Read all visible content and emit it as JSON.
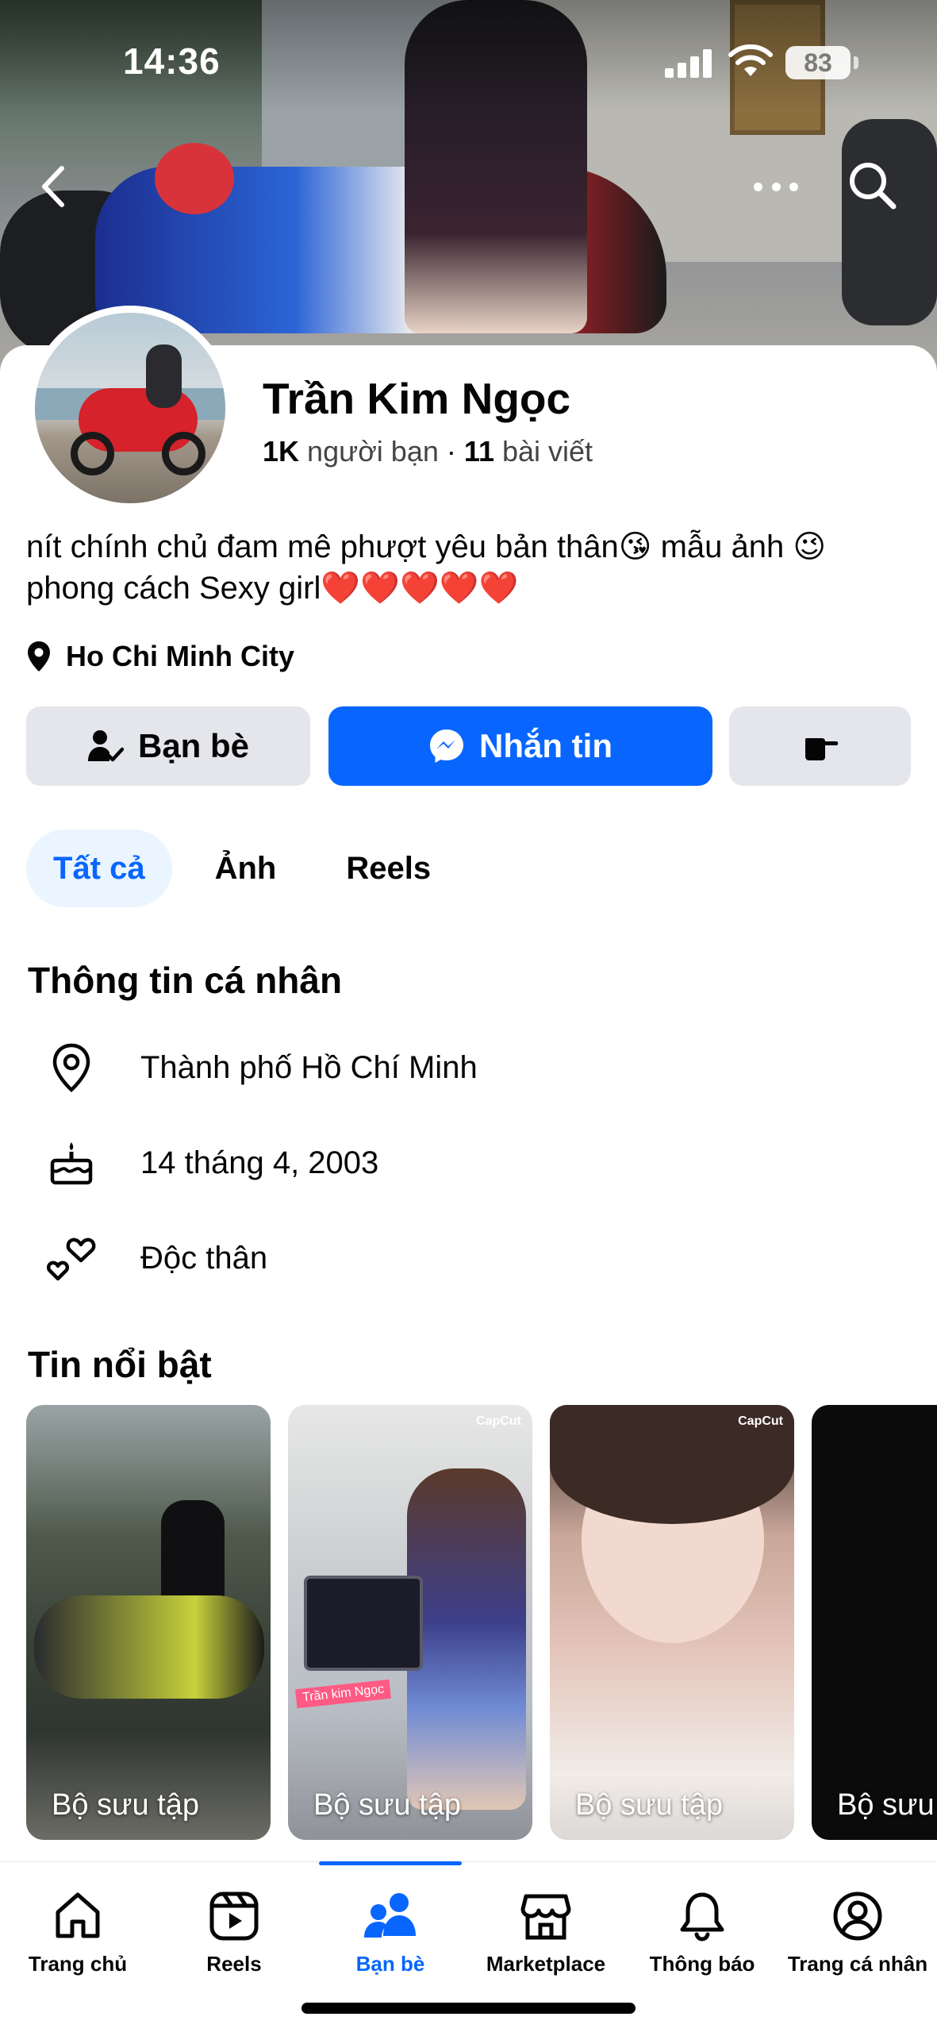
{
  "status_bar": {
    "time": "14:36",
    "battery": "83"
  },
  "profile": {
    "name": "Trần Kim Ngọc",
    "friends_count": "1K",
    "friends_label": "người bạn",
    "separator": "·",
    "posts_count": "11",
    "posts_label": "bài viết",
    "bio_line1": "nít chính chủ đam mê phượt yêu bản thân😘 mẫu ảnh 😉",
    "bio_line2": "phong cách Sexy girl❤️❤️❤️❤️❤️",
    "location": "Ho Chi Minh City"
  },
  "actions": {
    "friends": "Bạn bè",
    "message": "Nhắn tin"
  },
  "tabs": [
    {
      "label": "Tất cả"
    },
    {
      "label": "Ảnh"
    },
    {
      "label": "Reels"
    }
  ],
  "about": {
    "title": "Thông tin cá nhân",
    "city": "Thành phố Hồ Chí Minh",
    "birthday": "14 tháng 4, 2003",
    "relationship": "Độc thân"
  },
  "highlights": {
    "title": "Tin nổi bật",
    "items": [
      {
        "label": "Bộ sưu tập"
      },
      {
        "label": "Bộ sưu tập",
        "badge": "CapCut",
        "tag": "Trần kim Ngọc"
      },
      {
        "label": "Bộ sưu tập",
        "badge": "CapCut"
      },
      {
        "label": "Bộ sưu"
      }
    ]
  },
  "nav": [
    {
      "label": "Trang chủ",
      "icon": "home-icon"
    },
    {
      "label": "Reels",
      "icon": "reels-icon"
    },
    {
      "label": "Bạn bè",
      "icon": "friends-icon",
      "active": true
    },
    {
      "label": "Marketplace",
      "icon": "marketplace-icon"
    },
    {
      "label": "Thông báo",
      "icon": "bell-icon"
    },
    {
      "label": "Trang cá nhân",
      "icon": "profile-icon"
    }
  ],
  "colors": {
    "accent": "#0866ff",
    "button_gray": "#e4e6eb",
    "tab_active_bg": "#ebf5ff"
  }
}
